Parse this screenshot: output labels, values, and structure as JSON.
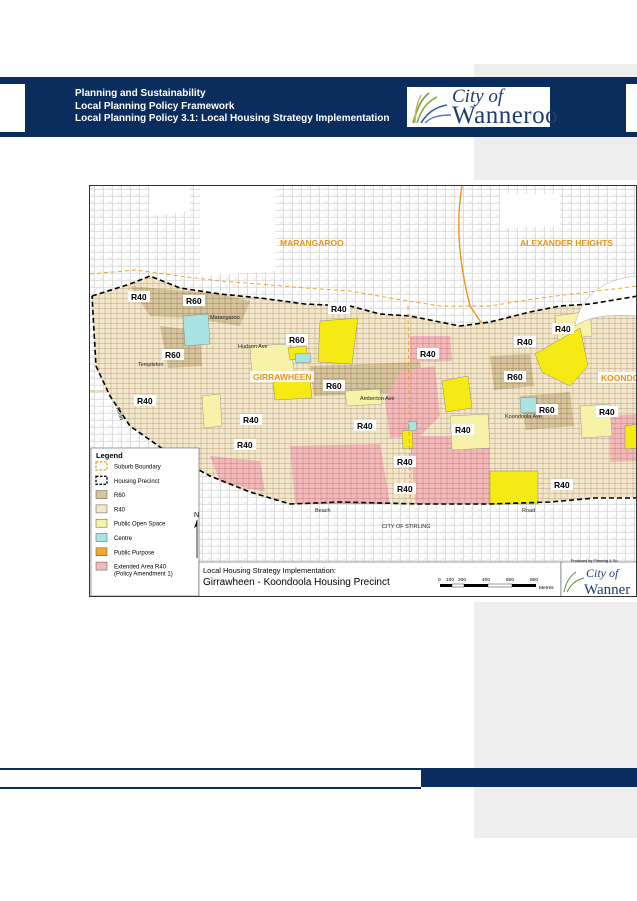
{
  "header": {
    "line1": "Planning and Sustainability",
    "line2": "Local Planning Policy Framework",
    "line3": "Local Planning Policy 3.1: Local Housing  Strategy Implementation"
  },
  "logo": {
    "city": "City of",
    "name": "Wanneroo"
  },
  "map": {
    "suburbs": [
      "MARANGAROO",
      "ALEXANDER HEIGHTS",
      "GIRRAWHEEN",
      "KOONDOOLA"
    ],
    "zone_labels": {
      "r40": "R40",
      "r60": "R60"
    },
    "streets": {
      "marangaroo": "Marangaroo",
      "hudson": "Hudson Ave",
      "templeton": "Templeton",
      "amberton": "Amberton Ave",
      "koondoola": "Koondoola Ave",
      "beach": "Beach",
      "road_right": "Road",
      "road_left": "Road",
      "city_of_stirling": "CITY OF STIRLING"
    },
    "north": "N",
    "title_line1": "Local Housing Strategy Implementation:",
    "title_line2": "Girrawheen - Koondoola Housing Precinct",
    "scale": {
      "ticks": [
        "0",
        "100",
        "200",
        "400",
        "600",
        "800"
      ],
      "unit": "Metres"
    },
    "produced_by": "Produced by Planning & Su",
    "small_logo": {
      "city": "City of",
      "name": "Wanner"
    }
  },
  "legend": {
    "title": "Legend",
    "items": [
      {
        "label": "Suburb Boundary",
        "color": "#ffffff",
        "border": "#e8a020",
        "style": "dashed"
      },
      {
        "label": "Housing Precinct",
        "color": "#ffffff",
        "border": "#000000",
        "style": "dashed"
      },
      {
        "label": "R60",
        "color": "#d8c49a",
        "border": "#555555",
        "style": "solid"
      },
      {
        "label": "R40",
        "color": "#f4e6c8",
        "border": "#555555",
        "style": "solid"
      },
      {
        "label": "Public Open Space",
        "color": "#f6f3a8",
        "border": "#555555",
        "style": "solid"
      },
      {
        "label": "Centre",
        "color": "#a8e4e4",
        "border": "#555555",
        "style": "solid"
      },
      {
        "label": "Public Purpose",
        "color": "#f0a830",
        "border": "#555555",
        "style": "solid"
      },
      {
        "label": "Extended Area R40",
        "color": "#f4b8b8",
        "border": "#555555",
        "style": "solid"
      },
      {
        "label": "(Policy Amendment 1)",
        "color": "",
        "border": "",
        "style": "none"
      }
    ]
  },
  "colors": {
    "navy": "#0a2d5e",
    "r40": "#f4e6c8",
    "r60": "#d8c49a",
    "open_space": "#f6f3a8",
    "yellow": "#f5ea14",
    "pink": "#f4b8b8",
    "centre": "#a8e4e4",
    "suburb_label": "#e8961a"
  }
}
